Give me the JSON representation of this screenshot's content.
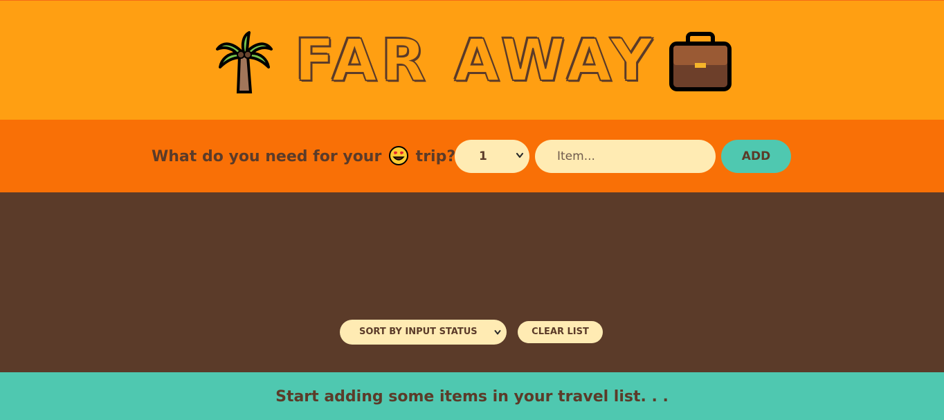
{
  "header": {
    "title": "FAR AWAY",
    "left_icon": "palm-tree-icon",
    "right_icon": "briefcase-icon"
  },
  "form": {
    "question_before": "What do you need for your",
    "question_emoji": "heart-eyes-emoji-icon",
    "question_after": "trip?",
    "quantity_selected": "1",
    "item_placeholder": "Item...",
    "add_label": "ADD"
  },
  "list": {
    "sort_selected": "SORT BY INPUT STATUS",
    "clear_label": "CLEAR LIST"
  },
  "footer": {
    "message": "Start adding some items in your travel list. . ."
  },
  "colors": {
    "header_bg": "#ff9f12",
    "form_bg": "#f97006",
    "list_bg": "#5b3b29",
    "footer_bg": "#4fc8b0",
    "input_bg": "#ffebb3",
    "text_brown": "#5b3b29"
  }
}
